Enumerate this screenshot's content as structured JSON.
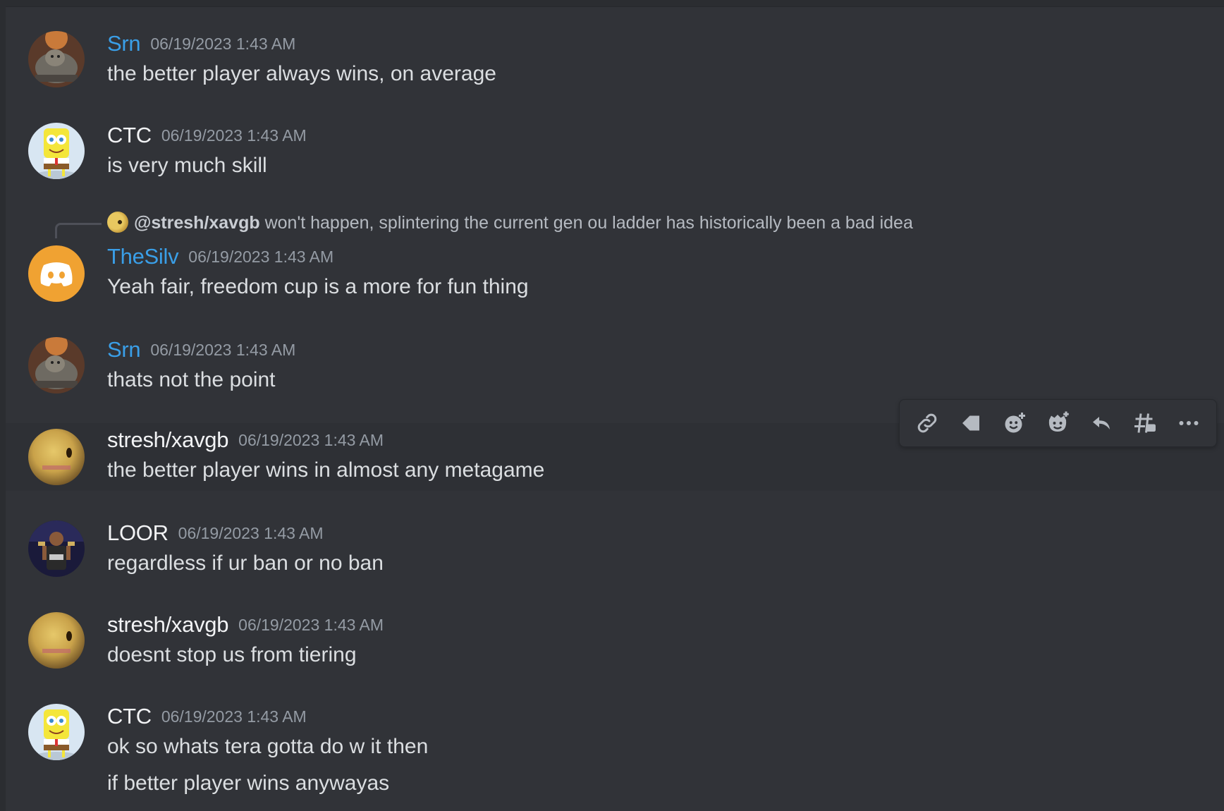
{
  "messages": [
    {
      "author": "Srn",
      "timestamp": "06/19/2023 1:43 AM",
      "lines": [
        "the better player always wins, on average"
      ],
      "avatar": "gorilla-avatar"
    },
    {
      "author": "CTC",
      "timestamp": "06/19/2023 1:43 AM",
      "lines": [
        "is very much skill"
      ],
      "avatar": "spongebob-avatar"
    },
    {
      "author": "TheSilv",
      "timestamp": "06/19/2023 1:43 AM",
      "lines": [
        "Yeah fair, freedom cup is a more for fun thing"
      ],
      "avatar": "discord-default-avatar",
      "reply": {
        "mention": "@stresh/xavgb",
        "text": "won't happen, splintering the current gen ou ladder has historically been a bad idea"
      }
    },
    {
      "author": "Srn",
      "timestamp": "06/19/2023 1:43 AM",
      "lines": [
        "thats not the point"
      ],
      "avatar": "gorilla-avatar"
    },
    {
      "author": "stresh/xavgb",
      "timestamp": "06/19/2023 1:43 AM",
      "lines": [
        "the better player wins in almost any metagame"
      ],
      "avatar": "blurry-yellow-avatar"
    },
    {
      "author": "LOOR",
      "timestamp": "06/19/2023 1:43 AM",
      "lines": [
        "regardless if ur ban or no ban"
      ],
      "avatar": "wrestler-avatar"
    },
    {
      "author": "stresh/xavgb",
      "timestamp": "06/19/2023 1:43 AM",
      "lines": [
        "doesnt stop us from tiering"
      ],
      "avatar": "blurry-yellow-avatar"
    },
    {
      "author": "CTC",
      "timestamp": "06/19/2023 1:43 AM",
      "lines": [
        "ok so whats tera gotta do w it then",
        "if better player wins anywayas"
      ],
      "avatar": "spongebob-avatar"
    }
  ],
  "toolbar": {
    "icons": [
      "link-icon",
      "tag-icon",
      "add-reaction-icon",
      "super-reaction-icon",
      "reply-icon",
      "create-thread-icon",
      "more-icon"
    ]
  },
  "colors": {
    "background": "#313338",
    "link_blue_name": "#3a9fe8",
    "timestamp": "#949ba4",
    "message_text": "#dbdee1",
    "discord_default_avatar": "#f0a232"
  }
}
